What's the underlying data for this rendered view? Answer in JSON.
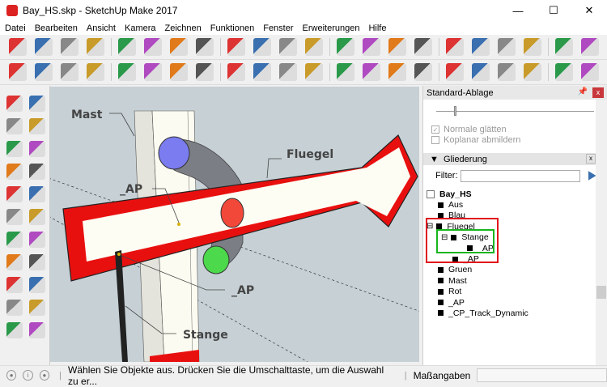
{
  "window": {
    "title": "Bay_HS.skp - SketchUp Make 2017",
    "minimize": "—",
    "maximize": "☐",
    "close": "✕"
  },
  "menu": [
    "Datei",
    "Bearbeiten",
    "Ansicht",
    "Kamera",
    "Zeichnen",
    "Funktionen",
    "Fenster",
    "Erweiterungen",
    "Hilfe"
  ],
  "toolbar1": [
    "new-icon",
    "open-icon",
    "save-icon",
    "cut-icon",
    "copy-icon",
    "paste-icon",
    "erase-icon",
    "undo-icon",
    "redo-icon",
    "print-icon",
    "model-info-icon",
    "pencil-icon",
    "arc-icon",
    "freehand-icon",
    "rectangle-icon",
    "rotated-rect-icon",
    "circle-icon",
    "polygon-icon",
    "warehouse-icon",
    "extension-icon",
    "home-icon",
    "zoom-extents-icon"
  ],
  "toolbar2": [
    "select-icon",
    "eraser-icon",
    "line-icon",
    "arc2-icon",
    "shapes-icon",
    "pushpull-icon",
    "followme-icon",
    "move-icon",
    "rotate-icon",
    "scale-icon",
    "offset-icon",
    "tape-icon",
    "text-icon",
    "paint-icon",
    "orbit-icon",
    "pan-icon",
    "zoom-icon",
    "zoom-window-icon",
    "scenes-icon",
    "section-icon",
    "ruby-icon",
    "layers-icon"
  ],
  "scene": {
    "labels": {
      "mast": "Mast",
      "fluegel": "Fluegel",
      "ap1": "_AP",
      "ap2": "_AP",
      "stange": "Stange"
    },
    "colors": {
      "background": "#c6d0d5",
      "wing_red": "#e8100f",
      "wing_white": "#fdfdf3",
      "blue": "#7a7cf0",
      "red": "#f2483a",
      "green": "#4cd94c",
      "gray": "#7c7e86"
    }
  },
  "panel": {
    "title": "Standard-Ablage",
    "smooth": {
      "normals_label": "Normale glätten",
      "normals_checked": true,
      "coplanar_label": "Koplanar abmildern",
      "coplanar_checked": false,
      "slider_value": 0.12
    },
    "outliner": {
      "title": "Gliederung",
      "filter_label": "Filter:",
      "filter_value": "",
      "root": "Bay_HS",
      "items": [
        {
          "label": "Aus",
          "depth": 0
        },
        {
          "label": "Blau",
          "depth": 0
        },
        {
          "label": "Fluegel",
          "depth": 0,
          "expanded": true
        },
        {
          "label": "Stange",
          "depth": 1,
          "expanded": true
        },
        {
          "label": "_AP",
          "depth": 2
        },
        {
          "label": "_AP",
          "depth": 1
        },
        {
          "label": "Gruen",
          "depth": 0
        },
        {
          "label": "Mast",
          "depth": 0
        },
        {
          "label": "Rot",
          "depth": 0
        },
        {
          "label": "_AP",
          "depth": 0
        },
        {
          "label": "_CP_Track_Dynamic",
          "depth": 0
        }
      ]
    }
  },
  "status": {
    "message": "Wählen Sie Objekte aus. Drücken Sie die Umschalttaste, um die Auswahl zu er...",
    "measurements_label": "Maßangaben",
    "measurements_value": ""
  }
}
